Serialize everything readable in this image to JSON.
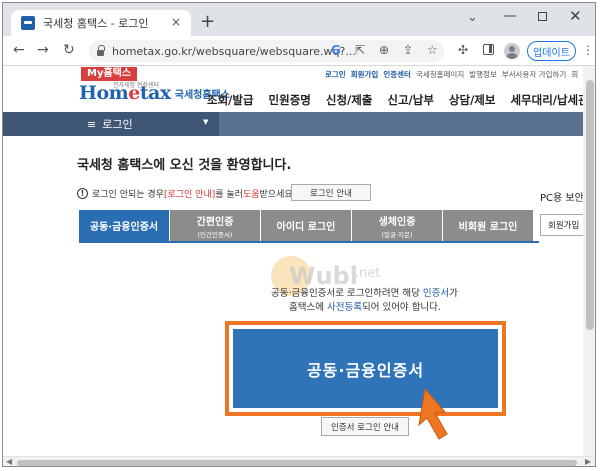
{
  "browser": {
    "tab_title": "국세청 홈택스 - 로그인",
    "tab_close": "×",
    "new_tab": "+",
    "url": "hometax.go.kr/websquare/websquare.wq?...",
    "update_label": "업데이트",
    "icons": [
      "back-icon",
      "forward-icon",
      "reload-icon",
      "lock-icon",
      "google-icon",
      "share-icon",
      "zoom-icon",
      "bookmark-icon",
      "star-icon",
      "extensions-icon",
      "side-panel-icon",
      "profile-icon",
      "menu-icon"
    ],
    "controls": {
      "back": "←",
      "forward": "→",
      "reload": "↻",
      "google": "G",
      "share": "⇪",
      "zoom": "⊕",
      "open": "⇱",
      "star": "☆",
      "puzzle": "✣",
      "kebab": "⋮",
      "chevron": "⌄",
      "minimize": "—",
      "close": "✕"
    }
  },
  "site": {
    "my_hometax": "My홈택스",
    "util_links": [
      {
        "label": "로그인",
        "emphasis": true
      },
      {
        "label": "회원가입",
        "emphasis": true
      },
      {
        "label": "인증센터",
        "emphasis": true
      },
      {
        "label": "국세청홈페이지",
        "emphasis": false
      },
      {
        "label": "발행정보",
        "emphasis": false
      },
      {
        "label": "부서사용자 가입하기",
        "emphasis": false
      },
      {
        "label": "회",
        "emphasis": false
      }
    ],
    "logo_home": "Hom",
    "logo_e": "e",
    "logo_tax": "tax",
    "logo_tagline": "전자세정 현장센터",
    "logo_nts": "국세청홈택스",
    "gnb": [
      "조회/발급",
      "민원증명",
      "신청/제출",
      "신고/납부",
      "상담/제보",
      "세무대리/납세관리"
    ],
    "nav_menu_icon": "≡",
    "nav_label": "로그인",
    "nav_caret": "▼"
  },
  "login": {
    "welcome": "국세청 홈택스에 오신 것을 환영합니다.",
    "notice_icon": "!",
    "notice_prefix": "로그인 안되는 경우 ",
    "notice_link": "[로그인 안내]",
    "notice_middle": "를 눌러 ",
    "notice_help": "도움",
    "notice_suffix": "받으세요.",
    "guide_button": "로그인 안내",
    "pc_security": "PC용 보안",
    "tabs": [
      {
        "label": "공동·금융인증서",
        "sub": "",
        "active": true
      },
      {
        "label": "간편인증",
        "sub": "(민간인증서)",
        "active": false
      },
      {
        "label": "아이디 로그인",
        "sub": "",
        "active": false
      },
      {
        "label": "생체인증",
        "sub": "(얼굴·지문)",
        "active": false
      },
      {
        "label": "비회원 로그인",
        "sub": "",
        "active": false
      }
    ],
    "member_signup": "회원가입",
    "guide_line1_prefix": "공동·금융인증서로 로그인하려면 해당 ",
    "guide_line1_link": "인증서",
    "guide_line1_suffix": "가",
    "guide_line2_prefix": "홈택스에 ",
    "guide_line2_link": "사전등록",
    "guide_line2_suffix": "되어 있어야 합니다.",
    "cert_button": "공동·금융인증서",
    "cert_guide_button": "인증서 로그인 안내"
  },
  "watermark": {
    "mark": "W",
    "text": "ubl",
    "net": ".net"
  },
  "colors": {
    "accent_orange": "#ee7622",
    "primary_blue": "#2f73b9",
    "tab_active": "#2a6db3",
    "tab_inactive": "#8c8c8c",
    "navbar": "#5a7190",
    "link_red": "#d83030"
  }
}
